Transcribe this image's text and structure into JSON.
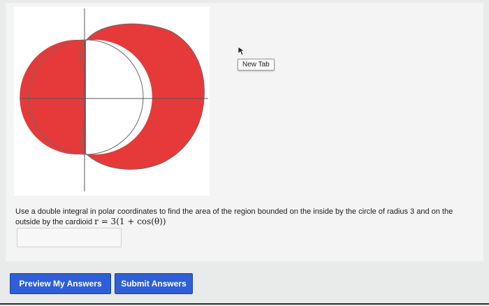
{
  "figure": {
    "fill_color": "#e63a3a",
    "description_shapes": [
      "circle-radius-3",
      "cardioid"
    ]
  },
  "tooltip": {
    "label": "New Tab"
  },
  "question": {
    "text_part1": "Use a double integral in polar coordinates to find the area of the region bounded on the inside by the circle of radius 3 and on the outside by the cardioid ",
    "math": "r = 3(1 + cos(θ))"
  },
  "answer": {
    "value": ""
  },
  "buttons": {
    "preview_label": "Preview My Answers",
    "submit_label": "Submit Answers"
  },
  "colors": {
    "button": "#2f5fd6",
    "region": "#e63a3a"
  }
}
